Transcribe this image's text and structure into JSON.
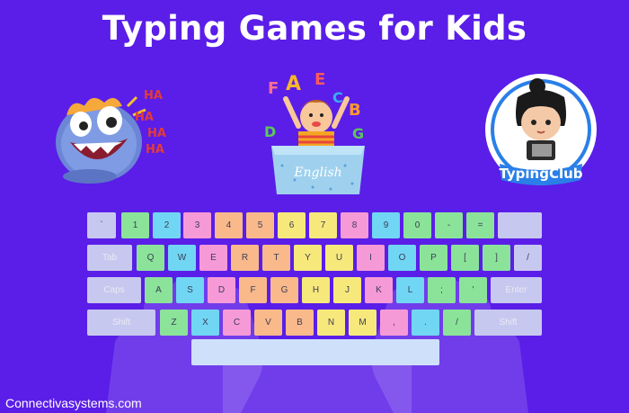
{
  "title": "Typing Games for Kids",
  "footer": "Connectivasystems.com",
  "monster_text": [
    "HA",
    "HA",
    "HA",
    "HA"
  ],
  "kid_box_label": "English",
  "kid_letters": [
    "F",
    "A",
    "E",
    "C",
    "B",
    "D",
    "G"
  ],
  "club_logo_text": "TypingClub",
  "keyboard": {
    "row1": [
      "`",
      "1",
      "2",
      "3",
      "4",
      "5",
      "6",
      "7",
      "8",
      "9",
      "0",
      "-",
      "=",
      ""
    ],
    "row2": [
      "Tab",
      "Q",
      "W",
      "E",
      "R",
      "T",
      "Y",
      "U",
      "I",
      "O",
      "P",
      "[",
      "]",
      "/"
    ],
    "row3": [
      "Caps",
      "A",
      "S",
      "D",
      "F",
      "G",
      "H",
      "J",
      "K",
      "L",
      ";",
      "'",
      "Enter"
    ],
    "row4": [
      "Shift",
      "Z",
      "X",
      "C",
      "V",
      "B",
      "N",
      "M",
      ",",
      ".",
      "/",
      "Shift"
    ],
    "row5": [
      ""
    ]
  },
  "colors": {
    "background": "#5a1ee8",
    "gray_key": "#c7c8ef",
    "green": "#8be39a",
    "cyan": "#71d6f3",
    "pink": "#f59ad7",
    "orange": "#f9b98b",
    "yellow": "#f7e87c",
    "space": "#cfe0fb"
  }
}
